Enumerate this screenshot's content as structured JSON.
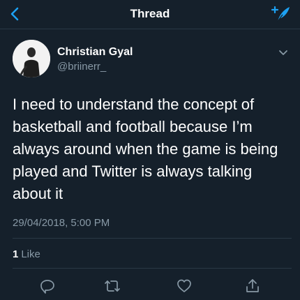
{
  "header": {
    "title": "Thread",
    "back_icon": "chevron-left-icon",
    "compose_icon": "compose-tweet-icon",
    "accent_color": "#1da1f2"
  },
  "tweet": {
    "author_name": "Christian Gyal",
    "author_handle": "@briinerr_",
    "text": "I need to understand the concept of basketball and football because I’m always around when the game is being played and Twitter is always talking about it",
    "timestamp": "29/04/2018, 5:00 PM",
    "like_count": "1",
    "like_label": "Like"
  },
  "actions": [
    {
      "icon": "reply-icon"
    },
    {
      "icon": "retweet-icon"
    },
    {
      "icon": "heart-icon"
    },
    {
      "icon": "share-icon"
    }
  ],
  "colors": {
    "background": "#15202b",
    "secondary_text": "#8899a6",
    "divider": "#2a3846"
  }
}
